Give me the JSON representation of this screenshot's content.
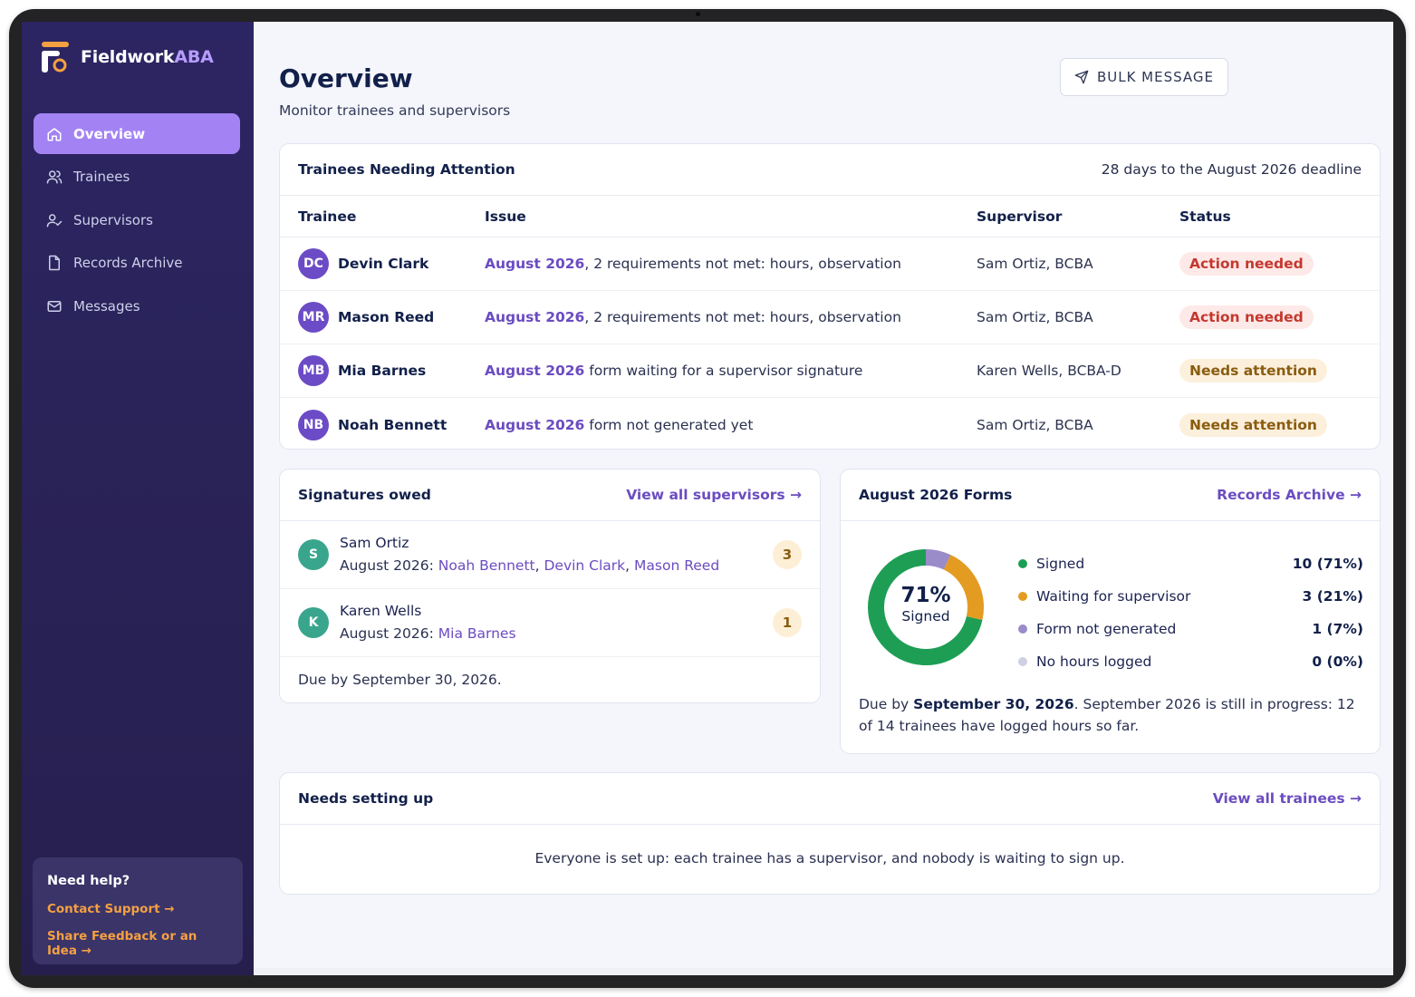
{
  "brand": {
    "name_main": "Fieldwork",
    "name_accent": "ABA"
  },
  "sidebar": {
    "items": [
      {
        "label": "Overview",
        "icon": "home-icon",
        "active": true
      },
      {
        "label": "Trainees",
        "icon": "users-icon"
      },
      {
        "label": "Supervisors",
        "icon": "user-check-icon"
      },
      {
        "label": "Records Archive",
        "icon": "file-icon"
      },
      {
        "label": "Messages",
        "icon": "mail-icon"
      }
    ],
    "help": {
      "title": "Need help?",
      "contact_label": "Contact Support →",
      "feedback_label": "Share Feedback or an Idea →"
    }
  },
  "header": {
    "title": "Overview",
    "subtitle": "Monitor trainees and supervisors",
    "bulk_message_label": "BULK MESSAGE"
  },
  "attention": {
    "title": "Trainees Needing Attention",
    "deadline": "28 days to the August 2026 deadline",
    "columns": [
      "Trainee",
      "Issue",
      "Supervisor",
      "Status"
    ],
    "rows": [
      {
        "initials": "DC",
        "name": "Devin Clark",
        "period": "August 2026",
        "issue": ", 2 requirements not met: hours, observation",
        "supervisor": "Sam Ortiz, BCBA",
        "status": "Action needed",
        "status_kind": "red"
      },
      {
        "initials": "MR",
        "name": "Mason Reed",
        "period": "August 2026",
        "issue": ", 2 requirements not met: hours, observation",
        "supervisor": "Sam Ortiz, BCBA",
        "status": "Action needed",
        "status_kind": "red"
      },
      {
        "initials": "MB",
        "name": "Mia Barnes",
        "period": "August 2026",
        "issue": " form waiting for a supervisor signature",
        "supervisor": "Karen Wells, BCBA-D",
        "status": "Needs attention",
        "status_kind": "amber"
      },
      {
        "initials": "NB",
        "name": "Noah Bennett",
        "period": "August 2026",
        "issue": " form not generated yet",
        "supervisor": "Sam Ortiz, BCBA",
        "status": "Needs attention",
        "status_kind": "amber"
      }
    ]
  },
  "signatures": {
    "title": "Signatures owed",
    "link": "View all supervisors →",
    "rows": [
      {
        "initial": "S",
        "name": "Sam Ortiz",
        "prefix": "August 2026: ",
        "trainees": [
          "Noah Bennett",
          "Devin Clark",
          "Mason Reed"
        ],
        "count": "3"
      },
      {
        "initial": "K",
        "name": "Karen Wells",
        "prefix": "August 2026: ",
        "trainees": [
          "Mia Barnes"
        ],
        "count": "1"
      }
    ],
    "due": "Due by September 30, 2026."
  },
  "forms": {
    "title": "August 2026 Forms",
    "link": "Records Archive →",
    "center_pct": "71%",
    "center_label": "Signed",
    "legend": [
      {
        "label": "Signed",
        "value": "10 (71%)",
        "color": "#1e9e55",
        "count": 10
      },
      {
        "label": "Waiting for supervisor",
        "value": "3 (21%)",
        "color": "#e39b21",
        "count": 3
      },
      {
        "label": "Form not generated",
        "value": "1 (7%)",
        "color": "#9a8bc9",
        "count": 1
      },
      {
        "label": "No hours logged",
        "value": "0 (0%)",
        "color": "#cfd0e2",
        "count": 0
      }
    ],
    "due_prefix": "Due by ",
    "due_date": "September 30, 2026",
    "due_suffix": ". September 2026 is still in progress: 12 of 14 trainees have logged hours so far."
  },
  "setup": {
    "title": "Needs setting up",
    "link": "View all trainees →",
    "message": "Everyone is set up: each trainee has a supervisor, and nobody is waiting to sign up."
  }
}
